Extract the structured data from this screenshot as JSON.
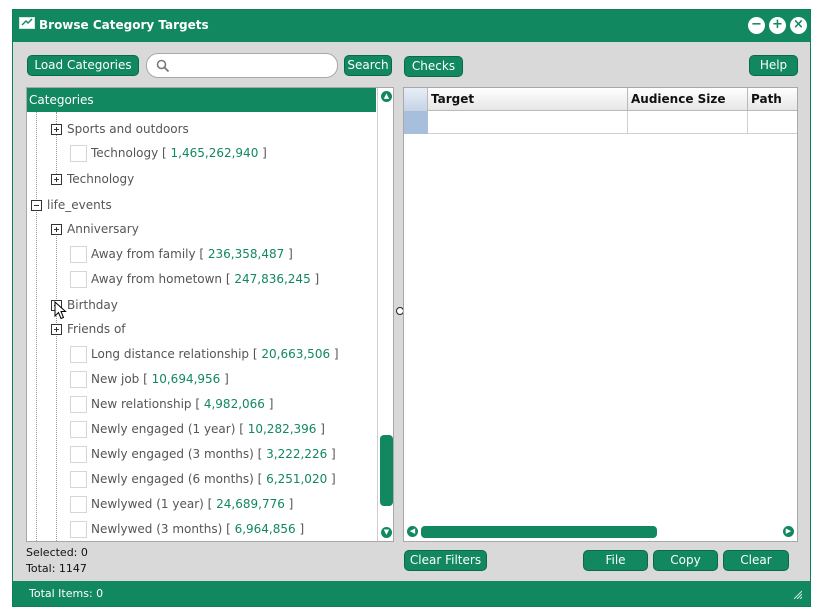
{
  "window": {
    "title": "Browse Category Targets",
    "controls": {
      "minimize": "−",
      "maximize": "+",
      "close": "×"
    }
  },
  "toolbar": {
    "load_label": "Load Categories",
    "search_placeholder": "",
    "search_value": "",
    "search_label": "Search",
    "checks_label": "Checks",
    "help_label": "Help"
  },
  "tree": {
    "header": "Categories",
    "rows": [
      {
        "type": "group",
        "label": "Sports and outdoors",
        "count": ""
      },
      {
        "type": "leaf",
        "label": "Technology",
        "count": "1,465,262,940"
      },
      {
        "type": "group",
        "label": "Technology",
        "count": ""
      },
      {
        "type": "root",
        "label": "life_events",
        "count": ""
      },
      {
        "type": "group",
        "label": "Anniversary",
        "count": ""
      },
      {
        "type": "leaf",
        "label": "Away from family",
        "count": "236,358,487"
      },
      {
        "type": "leaf",
        "label": "Away from hometown",
        "count": "247,836,245"
      },
      {
        "type": "group",
        "label": "Birthday",
        "count": ""
      },
      {
        "type": "group",
        "label": "Friends of",
        "count": ""
      },
      {
        "type": "leaf",
        "label": "Long distance relationship",
        "count": "20,663,506"
      },
      {
        "type": "leaf",
        "label": "New job",
        "count": "10,694,956"
      },
      {
        "type": "leaf",
        "label": "New relationship",
        "count": "4,982,066"
      },
      {
        "type": "leaf",
        "label": "Newly engaged (1 year)",
        "count": "10,282,396"
      },
      {
        "type": "leaf",
        "label": "Newly engaged (3 months)",
        "count": "3,222,226"
      },
      {
        "type": "leaf",
        "label": "Newly engaged (6 months)",
        "count": "6,251,020"
      },
      {
        "type": "leaf",
        "label": "Newlywed (1 year)",
        "count": "24,689,776"
      },
      {
        "type": "leaf",
        "label": "Newlywed (3 months)",
        "count": "6,964,856"
      }
    ]
  },
  "grid": {
    "columns": [
      "Target",
      "Audience Size",
      "Path"
    ],
    "rows": []
  },
  "actions": {
    "clear_filters": "Clear Filters",
    "file": "File",
    "copy": "Copy",
    "clear": "Clear"
  },
  "status": {
    "selected": "Selected: 0",
    "total": "Total: 1147",
    "total_items": "Total Items: 0"
  },
  "colors": {
    "accent": "#11885f",
    "count_text": "#11885f",
    "row_selector": "#a8bedd"
  },
  "icons": {
    "app": "window-icon",
    "search": "search-icon",
    "scroll_up": "chevron-up-icon",
    "scroll_down": "chevron-down-icon",
    "scroll_left": "chevron-left-icon",
    "scroll_right": "chevron-right-icon",
    "resize": "resize-grip-icon"
  }
}
